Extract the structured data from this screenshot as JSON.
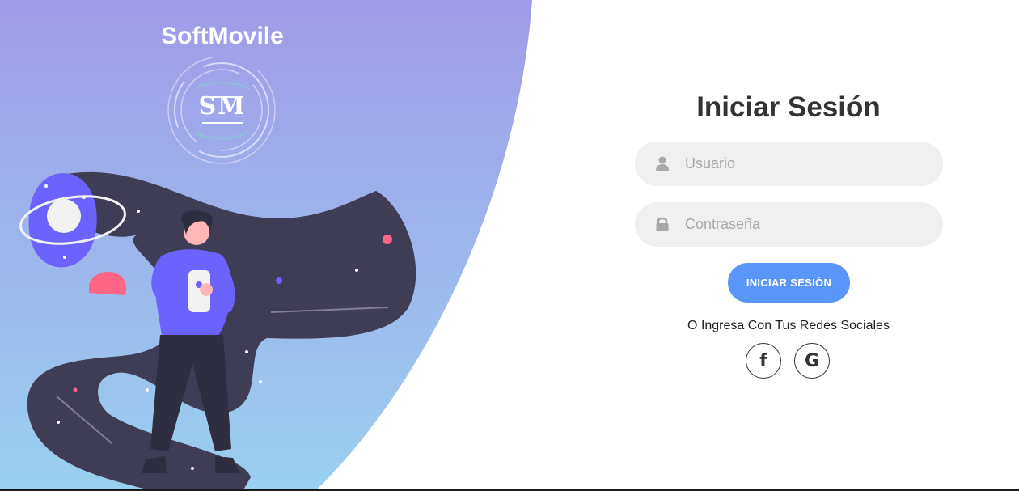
{
  "brand": {
    "name": "SoftMovile",
    "logo_text": "SM"
  },
  "login": {
    "title": "Iniciar Sesión",
    "username_placeholder": "Usuario",
    "password_placeholder": "Contraseña",
    "submit_label": "INICIAR SESIÓN",
    "social_caption": "O Ingresa Con Tus Redes Sociales",
    "social": [
      {
        "icon": "facebook-icon",
        "glyph": "f"
      },
      {
        "icon": "google-icon",
        "glyph": "G"
      }
    ]
  },
  "colors": {
    "hero_gradient_top": "#a19be8",
    "hero_gradient_bottom": "#9ad0f0",
    "accent_button": "#5996f7",
    "field_bg": "#f0f0f0",
    "planet_dark": "#3f3d56",
    "figure_shirt": "#6c63ff",
    "accent_pink": "#ff6584"
  }
}
